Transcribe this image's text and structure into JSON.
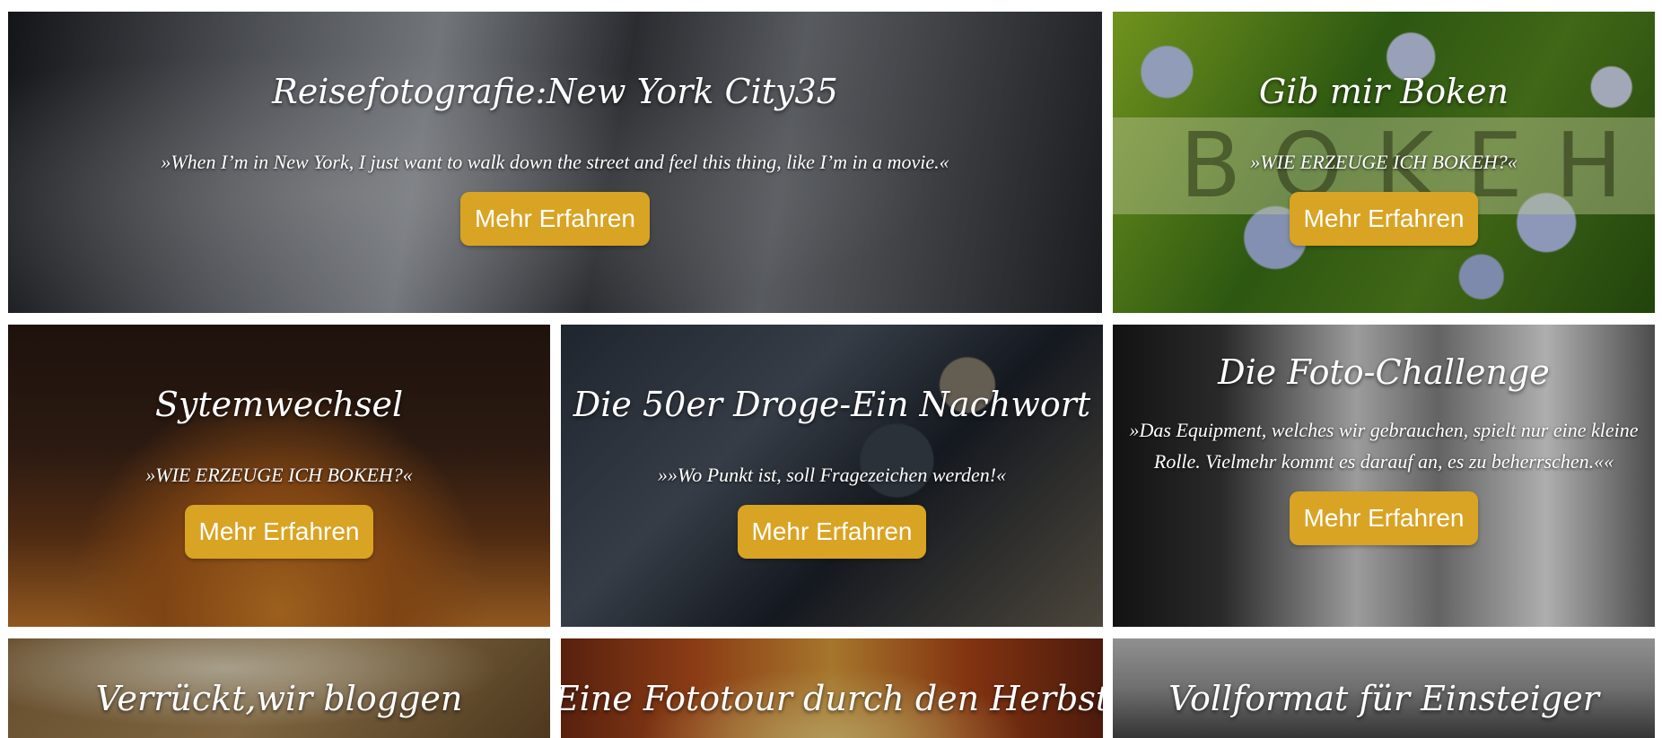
{
  "cards": [
    {
      "title": "Reisefotografie:New York City35",
      "quote": "»When I’m in New York, I just want to walk down the street and feel this thing, like I’m in a movie.«",
      "button": "Mehr Erfahren"
    },
    {
      "title": "Gib mir Boken",
      "quote": "»WIE ERZEUGE ICH BOKEH?«",
      "button": "Mehr Erfahren",
      "overlay_text": "BOKEH"
    },
    {
      "title": "Sytemwechsel",
      "quote": "»WIE ERZEUGE ICH BOKEH?«",
      "button": "Mehr Erfahren"
    },
    {
      "title": "Die 50er Droge-Ein Nachwort",
      "quote": "»»Wo Punkt ist, soll Fragezeichen werden!«",
      "button": "Mehr Erfahren"
    },
    {
      "title": "Die Foto-Challenge",
      "quote": "»Das Equipment, welches wir gebrauchen, spielt nur eine kleine Rolle. Vielmehr kommt es darauf an, es zu beherrschen.««",
      "button": "Mehr Erfahren"
    },
    {
      "title": "Verrückt,wir bloggen"
    },
    {
      "title": "Eine Fototour durch den Herbst"
    },
    {
      "title": "Vollformat für Einsteiger"
    }
  ],
  "colors": {
    "button_bg": "#d9a323",
    "button_text": "#ffffff"
  }
}
